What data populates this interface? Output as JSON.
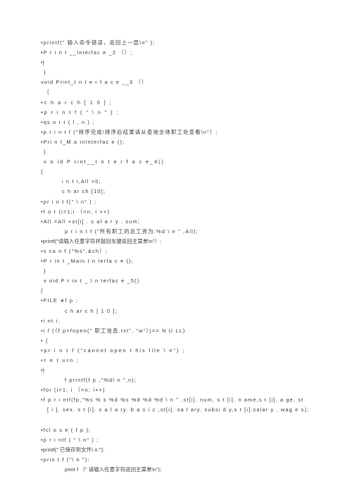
{
  "document": {
    "type": "scanned-code-listing",
    "page_background": "#ffffff",
    "text_color": "#3b3b45",
    "language": "C",
    "lines": [
      {
        "id": "l01",
        "indent": 0,
        "spacing": "sp1",
        "text": "•printf(\" 输入命令错误，返回上一层\\n\" );"
      },
      {
        "id": "l02",
        "indent": 0,
        "spacing": "sp1",
        "text": "•P r i n t __Interfac e _2 （）;"
      },
      {
        "id": "l03",
        "indent": 0,
        "spacing": "sp0",
        "text": "•}"
      },
      {
        "id": "l04",
        "indent": 1,
        "spacing": "sp0",
        "text": "}"
      },
      {
        "id": "l05",
        "indent": 0,
        "spacing": "sp1",
        "text": "void Print_I n t e r f a c e __3 （）"
      },
      {
        "id": "l06",
        "indent": 1,
        "spacing": "sp0",
        "text": "｛"
      },
      {
        "id": "l07",
        "indent": 0,
        "spacing": "sp2",
        "text": "•c h a r  c h [ 1 0 ] ;"
      },
      {
        "id": "l08",
        "indent": 0,
        "spacing": "sp2",
        "text": "•p r i n t f ( \" \\ n \" ) ;"
      },
      {
        "id": "l09",
        "indent": 0,
        "spacing": "sp1",
        "text": "•qs o r t ( l , n ) ;"
      },
      {
        "id": "l10",
        "indent": 0,
        "spacing": "sp1",
        "text": "•p r i n t f (\"排序完成!排序后结果请从查询全体职工处查看\\n\"）;"
      },
      {
        "id": "l11",
        "indent": 0,
        "spacing": "sp1",
        "text": "•Pri n t_M a inInterfac e ();"
      },
      {
        "id": "l12",
        "indent": 1,
        "spacing": "sp0",
        "text": "}"
      },
      {
        "id": "l13",
        "indent": 1,
        "spacing": "sp2",
        "text": "v o id  P rint__I n t e r f a c e_4()"
      },
      {
        "id": "l14",
        "indent": 0,
        "spacing": "sp0",
        "text": "{"
      },
      {
        "id": "l15",
        "indent": 3,
        "spacing": "sp1",
        "text": "i n t i,All =0;"
      },
      {
        "id": "l16",
        "indent": 3,
        "spacing": "sp1",
        "text": "c h ar ch [10];"
      },
      {
        "id": "l17",
        "indent": 0,
        "spacing": "sp1",
        "text": "•pr i n t f(\" \\ n\" ) ;"
      },
      {
        "id": "l18",
        "indent": 0,
        "spacing": "sp1",
        "text": "•f o r  (i=1;i （=n; i ++)"
      },
      {
        "id": "l19",
        "indent": 0,
        "spacing": "sp1",
        "text": "•All =All +st[i] . s al a r y . sum;"
      },
      {
        "id": "l20",
        "indent": 4,
        "spacing": "sp1",
        "text": "p r i n t  f (\"所有职工的总工资为:%d \\ n \" ,All);"
      },
      {
        "id": "l21",
        "indent": 0,
        "spacing": "sp0",
        "text": "•printf(\"请输入任意字符并敲回车键返回主菜单\\n\"）;"
      },
      {
        "id": "l22",
        "indent": 0,
        "spacing": "sp1",
        "text": "•s ca n  f (\"%s\",&ch）;"
      },
      {
        "id": "l23",
        "indent": 0,
        "spacing": "sp1",
        "text": "•P r in t _Main I n terfa c e ();"
      },
      {
        "id": "l24",
        "indent": 1,
        "spacing": "sp0",
        "text": "}"
      },
      {
        "id": "l25",
        "indent": 1,
        "spacing": "sp1",
        "text": "v oid P r in t _ I n terfac e _5()"
      },
      {
        "id": "l26",
        "indent": 0,
        "spacing": "sp0",
        "text": "{"
      },
      {
        "id": "l27",
        "indent": 0,
        "spacing": "sp1",
        "text": "•FILE ∗f p ;"
      },
      {
        "id": "l28",
        "indent": 4,
        "spacing": "sp1",
        "text": "c h ar  c h  [ 1 0 ];"
      },
      {
        "id": "l29",
        "indent": 0,
        "spacing": "sp1",
        "text": "•i nt i;"
      },
      {
        "id": "l30",
        "indent": 0,
        "spacing": "sp1",
        "text": "•i f  (（f p=fopen(\" 职工信息.txt\", \"w\"）)== N U LL)"
      },
      {
        "id": "l31",
        "indent": 0,
        "spacing": "sp1",
        "text": "• {"
      },
      {
        "id": "l32",
        "indent": 0,
        "spacing": "sp2",
        "text": "•pr i n t f (\"cannot open t his  file \\ n\") ;"
      },
      {
        "id": "l33",
        "indent": 0,
        "spacing": "sp2",
        "text": "•r e t urn ;"
      },
      {
        "id": "l34",
        "indent": 0,
        "spacing": "sp0",
        "text": "•}"
      },
      {
        "id": "l35",
        "indent": 4,
        "spacing": "sp1",
        "text": "f printf(f p ,\"%d\\ n \",n);"
      },
      {
        "id": "l36",
        "indent": 0,
        "spacing": "sp1",
        "text": "•for (i=1; i （=n; i++)"
      },
      {
        "id": "l37",
        "indent": 0,
        "spacing": "sp1",
        "text": "•f p r i ntf(fp,\"%s % s  %d  %s  %d %d %d \\ n \" ,st[i]. num, s t [i]. n ame,s t [i]. a ge, st"
      },
      {
        "id": "l38",
        "indent": 2,
        "spacing": "sp1",
        "text": "[ i ]. sex. s t [i]. s a l a ry. b a s i c ,st[i]. sa l ary. subsi d y,s t [i].salar y . wag e s);"
      },
      {
        "id": "l39",
        "indent": 0,
        "spacing": "sp1",
        "text": ""
      },
      {
        "id": "l40",
        "indent": 0,
        "spacing": "sp1",
        "text": "•fcl o s e ( f p );"
      },
      {
        "id": "l41",
        "indent": 0,
        "spacing": "sp1",
        "text": "•p r i ntf ( \" \\ n\" ) ;"
      },
      {
        "id": "l42",
        "indent": 0,
        "spacing": "sp0",
        "text": "•printf(\" 已保存到文件\\ n \");"
      },
      {
        "id": "l43",
        "indent": 0,
        "spacing": "sp1",
        "text": "•prin t f (\"\\ n \");"
      },
      {
        "id": "l44",
        "indent": 4,
        "spacing": "sp0",
        "text": "print f （\" 请输入任意字符返回主菜单\\n\");"
      }
    ]
  }
}
